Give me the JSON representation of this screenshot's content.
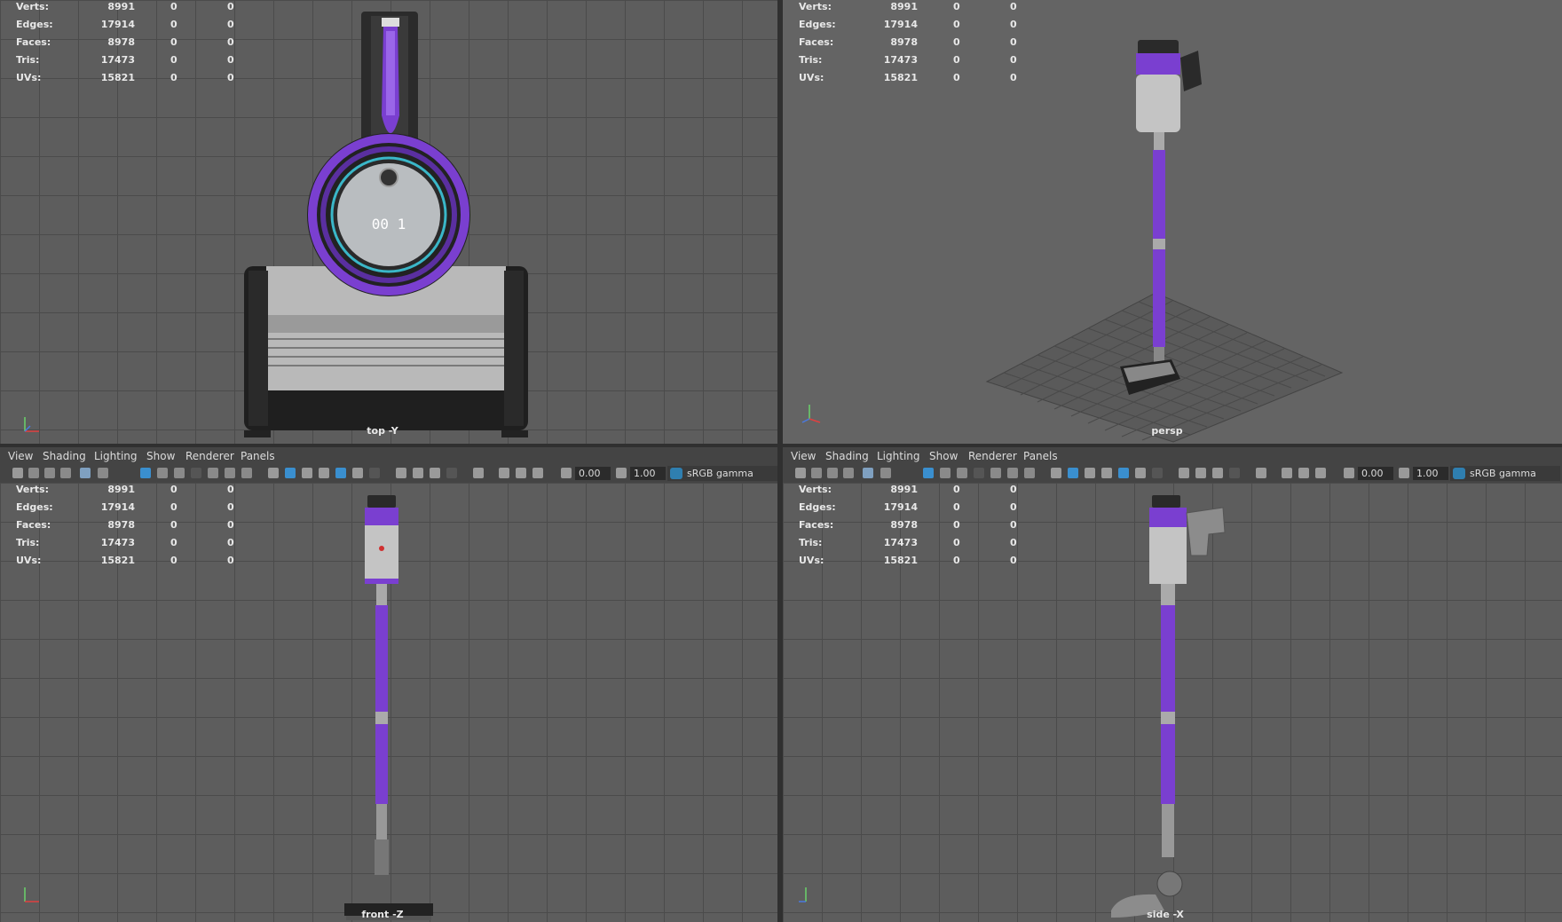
{
  "stats": {
    "labels": [
      "Verts:",
      "Edges:",
      "Faces:",
      "Tris:",
      "UVs:"
    ],
    "values": [
      "8991",
      "17914",
      "8978",
      "17473",
      "15821"
    ],
    "sel_a": [
      "0",
      "0",
      "0",
      "0",
      "0"
    ],
    "sel_b": [
      "0",
      "0",
      "0",
      "0",
      "0"
    ]
  },
  "viewports": {
    "top": {
      "label": "top -Y"
    },
    "persp": {
      "label": "persp"
    },
    "front": {
      "label": "front -Z"
    },
    "side": {
      "label": "side -X"
    }
  },
  "menu": [
    "View",
    "Shading",
    "Lighting",
    "Show",
    "Renderer",
    "Panels"
  ],
  "toolbar": {
    "exposure": "0.00",
    "gamma": "1.00",
    "colorspace": "sRGB gamma"
  },
  "colors": {
    "accent_purple": "#7a3fd0",
    "viewport_bg": "#5d5d5d",
    "toolbar_bg": "#444444",
    "highlight_blue": "#3a8fcf"
  }
}
